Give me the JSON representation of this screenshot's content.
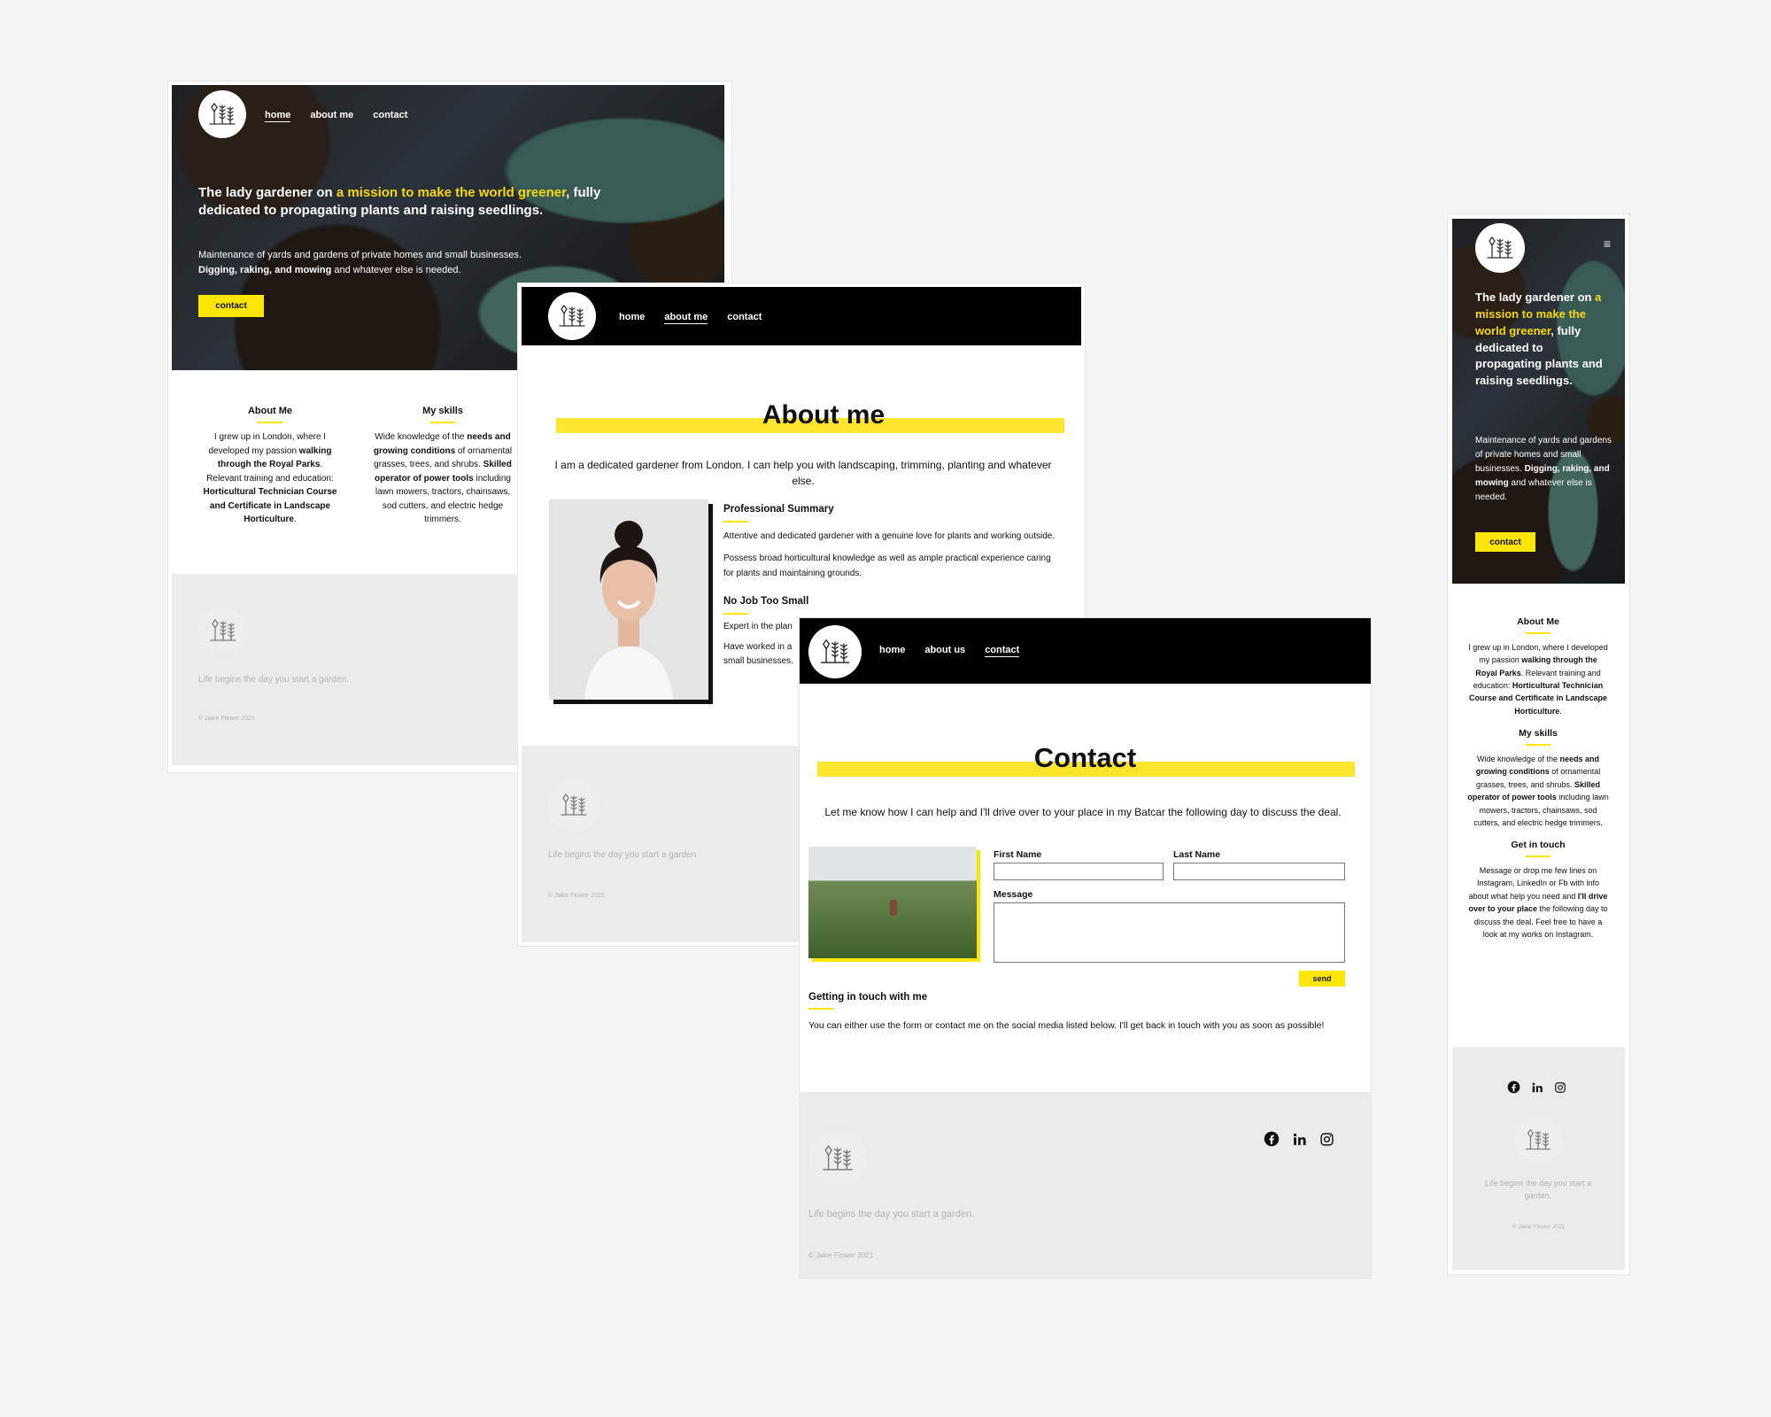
{
  "brand": {
    "footer_tagline": "Life begins the day you start a garden.",
    "footer_tagline_short": "Life begins the day you start a garden",
    "copyright": "© Jakie Flower 2021"
  },
  "colors": {
    "accent": "#ffe600",
    "nav_bg": "#000000",
    "footer_bg": "#ebebeb"
  },
  "home": {
    "nav": {
      "home": "home",
      "about": "about me",
      "contact": "contact"
    },
    "hero": {
      "title_a": "The lady gardener on ",
      "title_hl": "a mission to make the world greener",
      "title_b": ", fully dedicated to propagating plants and raising seedlings.",
      "text_a": "Maintenance of yards and gardens of private homes and small businesses.",
      "text_b_bold": "Digging, raking, and mowing",
      "text_b": " and whatever else is needed.",
      "cta": "contact"
    },
    "about_title": "About Me",
    "about_text_1": "I grew up in London, where I developed my passion ",
    "about_bold_1": "walking through the Royal Parks",
    "about_text_2": ". Relevant training and education: ",
    "about_bold_2": "Horticultural Technician Course and Certificate in Landscape Horticulture",
    "about_text_3": ".",
    "skills_title": "My skills",
    "skills_text_1": "Wide knowledge of the ",
    "skills_bold_1": "needs and growing conditions",
    "skills_text_2": " of ornamental grasses, trees, and shrubs. ",
    "skills_bold_2": "Skilled operator of power tools",
    "skills_text_3": " including lawn mowers, tractors, chainsaws, sod cutters, and electric hedge trimmers."
  },
  "about": {
    "nav": {
      "home": "home",
      "about": "about me",
      "contact": "contact"
    },
    "heading": "About me",
    "intro": "I am a dedicated gardener from London. I can help you with landscaping, trimming, planting and whatever else.",
    "summary_title": "Professional Summary",
    "summary_p1": "Attentive and dedicated gardener with a genuine love for plants and working outside.",
    "summary_p2": "Possess broad horticultural knowledge as well as ample practical experience caring for plants and maintaining grounds.",
    "job_title": "No Job Too Small",
    "job_p1": "Expert in the plan",
    "job_p2a": "Have worked in a",
    "job_p2b": "small businesses."
  },
  "contact": {
    "nav": {
      "home": "home",
      "about": "about us",
      "contact": "contact"
    },
    "heading": "Contact",
    "intro": "Let me know how I can help and I'll drive over to your place in my Batcar the following day to discuss the deal.",
    "first_name": "First Name",
    "last_name": "Last Name",
    "message": "Message",
    "send": "send",
    "touch_title": "Getting in touch with me",
    "touch_text": "You can either use the form or contact me on the social media listed below. I'll get back in touch with you as soon as possible!"
  },
  "mobile": {
    "menu_icon": "≡",
    "hero": {
      "title_a": "The lady gardener on ",
      "title_hl": "a mission to make the world greener",
      "title_b": ", fully dedicated to propagating plants and raising seedlings.",
      "text_a": "Maintenance of yards and gardens of private homes and small businesses. ",
      "text_b_bold": "Digging, raking, and mowing",
      "text_b": " and whatever else is needed.",
      "cta": "contact"
    },
    "about_title": "About Me",
    "skills_title": "My skills",
    "touch_title": "Get in touch",
    "touch_text_1": "Message or drop me few lines on Instagram, LinkedIn or Fb with info about what help you need and ",
    "touch_bold": "I'll drive over to your place",
    "touch_text_2": " the following day to discuss the deal. Feel free to have a look at my works on Instagram."
  },
  "icons": [
    "logo-icon",
    "facebook-icon",
    "linkedin-icon",
    "instagram-icon",
    "hamburger-icon"
  ]
}
